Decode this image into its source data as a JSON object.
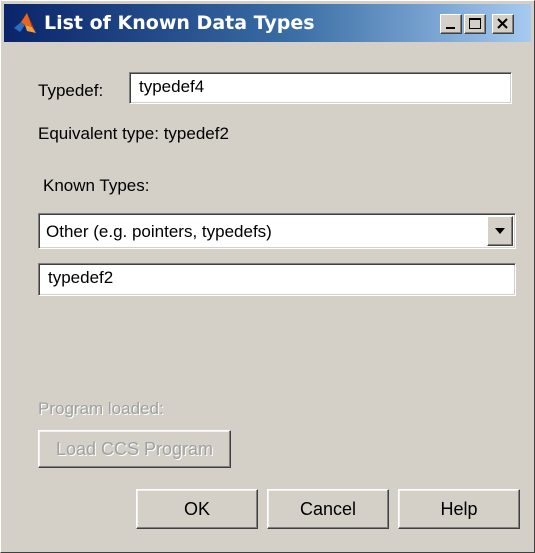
{
  "window": {
    "title": "List of Known Data Types",
    "controls": {
      "minimize_icon": "minimize-icon",
      "maximize_icon": "maximize-icon",
      "close_icon": "close-icon"
    }
  },
  "typedef": {
    "label": "Typedef:",
    "value": "typedef4"
  },
  "equivalent": {
    "text": "Equivalent type: typedef2"
  },
  "known_types": {
    "label": "Known Types:",
    "selected": "Other (e.g. pointers, typedefs)",
    "value": "typedef2"
  },
  "program": {
    "label": "Program loaded:",
    "load_button": "Load CCS Program"
  },
  "buttons": {
    "ok": "OK",
    "cancel": "Cancel",
    "help": "Help"
  },
  "colors": {
    "titlebar_start": "#0a246a",
    "titlebar_end": "#a6caf0",
    "face": "#d4d0c8",
    "disabled_text": "#a0a0a0"
  }
}
